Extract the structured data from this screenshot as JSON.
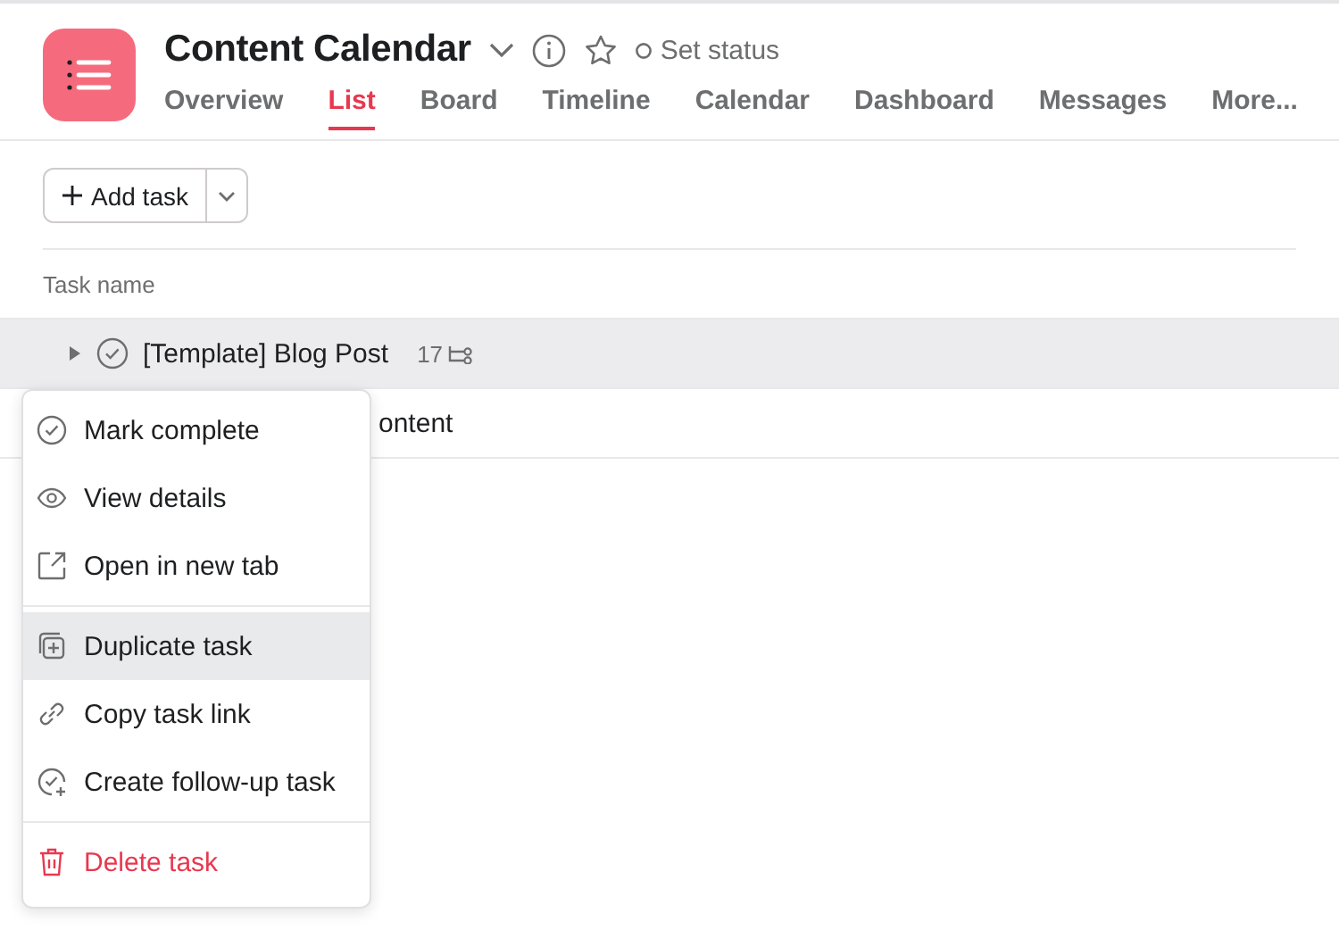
{
  "project": {
    "title": "Content Calendar",
    "status": "Set status"
  },
  "tabs": [
    {
      "label": "Overview",
      "selected": false
    },
    {
      "label": "List",
      "selected": true
    },
    {
      "label": "Board",
      "selected": false
    },
    {
      "label": "Timeline",
      "selected": false
    },
    {
      "label": "Calendar",
      "selected": false
    },
    {
      "label": "Dashboard",
      "selected": false
    },
    {
      "label": "Messages",
      "selected": false
    },
    {
      "label": "More...",
      "selected": false
    }
  ],
  "toolbar": {
    "add_button": "Add task"
  },
  "table": {
    "columns": [
      "Task name"
    ],
    "rows": [
      {
        "name": "[Template] Blog Post",
        "subtasks": "17",
        "selected": true
      },
      {
        "name": "ontent",
        "selected": false
      }
    ]
  },
  "context_menu": {
    "sections": [
      [
        {
          "label": "Mark complete",
          "kind": "normal",
          "selected": false
        },
        {
          "label": "View details",
          "kind": "normal",
          "selected": false
        },
        {
          "label": "Open in new tab",
          "kind": "normal",
          "selected": false
        }
      ],
      [
        {
          "label": "Duplicate task",
          "kind": "normal",
          "selected": true
        },
        {
          "label": "Copy task link",
          "kind": "normal",
          "selected": false
        },
        {
          "label": "Create follow-up task",
          "kind": "normal",
          "selected": false
        }
      ],
      [
        {
          "label": "Delete task",
          "kind": "danger",
          "selected": false
        }
      ]
    ]
  }
}
